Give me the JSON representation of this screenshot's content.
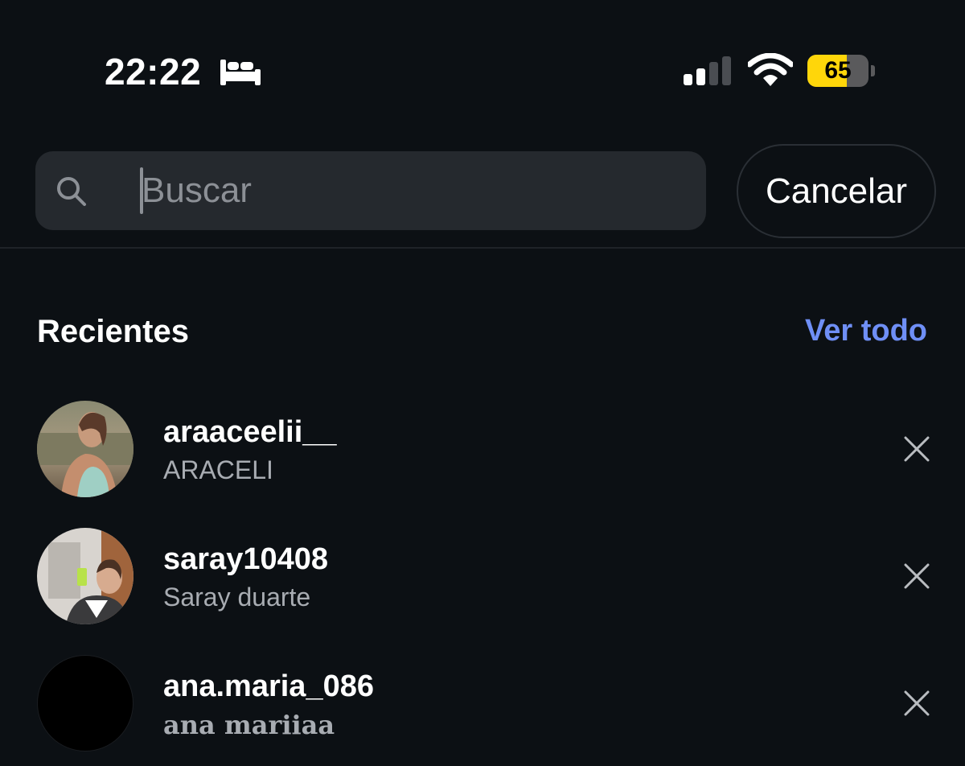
{
  "status_bar": {
    "time": "22:22",
    "battery_level": "65",
    "battery_fraction": 0.65,
    "icons": [
      "bed-icon",
      "signal-icon",
      "wifi-icon",
      "battery-icon"
    ],
    "colors": {
      "battery": "#ffd60a"
    }
  },
  "search": {
    "placeholder": "Buscar",
    "value": "",
    "cancel_label": "Cancelar"
  },
  "recents": {
    "title": "Recientes",
    "see_all_label": "Ver todo",
    "items": [
      {
        "username": "araaceelii__",
        "fullname": "ARACELI",
        "avatar": "photo-avatar"
      },
      {
        "username": "saray10408",
        "fullname": "Saray duarte",
        "avatar": "photo-avatar"
      },
      {
        "username": "ana.maria_086",
        "fullname": "ana mariiaa",
        "avatar": "black-avatar"
      }
    ]
  },
  "colors": {
    "background": "#0c1014",
    "search_field": "#25292e",
    "link": "#6f8ff6",
    "secondary_text": "#a8acb2"
  }
}
